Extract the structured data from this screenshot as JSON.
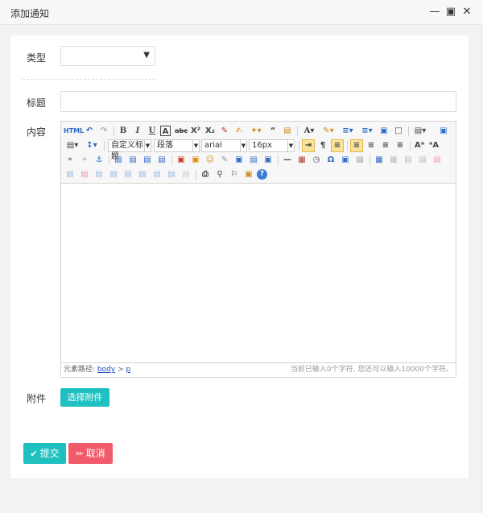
{
  "window": {
    "title": "添加通知",
    "minimize_icon": "minimize-icon",
    "maximize_icon": "maximize-icon",
    "close_icon": "close-icon"
  },
  "form": {
    "type_label": "类型",
    "type_selected": "",
    "title_label": "标题",
    "title_value": "",
    "content_label": "内容",
    "attachment_label": "附件",
    "attach_button": "选择附件",
    "submit_button": "提交",
    "cancel_button": "取消"
  },
  "editor": {
    "custom_heading": "自定义标题",
    "paragraph": "段落",
    "font_family": "arial",
    "font_size": "16px",
    "status_path_label": "元素路径:",
    "status_path_body": "body",
    "status_path_sep": ">",
    "status_path_p": "p",
    "char_count": "当前已输入0个字符, 您还可以输入10000个字符。"
  }
}
